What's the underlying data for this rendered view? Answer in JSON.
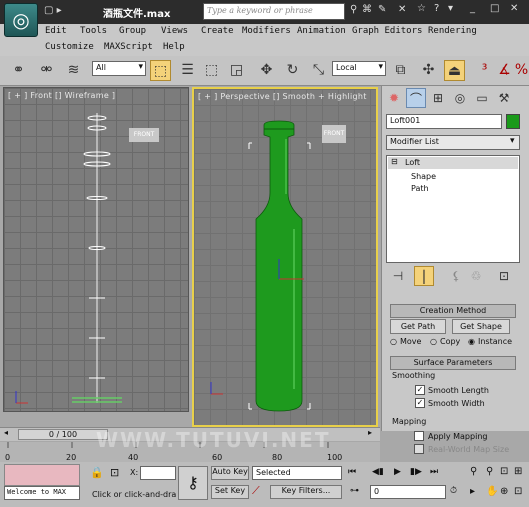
{
  "title": {
    "filename": "酒瓶文件.max",
    "search_placeholder": "Type a keyword or phrase"
  },
  "menu": {
    "edit": "Edit",
    "tools": "Tools",
    "group": "Group",
    "views": "Views",
    "create": "Create",
    "modifiers": "Modifiers",
    "animation": "Animation",
    "graph_editors": "Graph Editors",
    "rendering": "Rendering",
    "customize": "Customize",
    "maxscript": "MAXScript",
    "help": "Help"
  },
  "toolbar": {
    "selection_filter": "All",
    "ref_coord": "Local"
  },
  "viewports": {
    "front": "[ + ] Front [] Wireframe ]",
    "perspective": "[ + ] Perspective [] Smooth + Highlight",
    "view_cube": "FRONT"
  },
  "panel": {
    "object_name": "Loft001",
    "object_color": "#1a9a1a",
    "modifier_list": "Modifier List",
    "stack": [
      {
        "label": "Loft",
        "expander": "⊟"
      },
      {
        "label": "Shape"
      },
      {
        "label": "Path"
      }
    ],
    "creation_method": {
      "title": "Creation Method",
      "get_path": "Get Path",
      "get_shape": "Get Shape",
      "move": "Move",
      "copy": "Copy",
      "instance": "Instance"
    },
    "surface_params": {
      "title": "Surface Parameters",
      "smoothing": "Smoothing",
      "smooth_length": "Smooth Length",
      "smooth_width": "Smooth Width",
      "mapping": "Mapping",
      "apply_mapping": "Apply Mapping",
      "real_world": "Real-World Map Size"
    }
  },
  "timeline": {
    "frame": "0 / 100",
    "ticks": [
      "0",
      "20",
      "40",
      "60",
      "80",
      "100"
    ]
  },
  "status": {
    "maxscript": "Welcome to MAX",
    "prompt": "Click or click-and-dra",
    "x_label": "X:",
    "auto_key": "Auto Key",
    "set_key": "Set Key",
    "key_filters": "Key Filters...",
    "selected": "Selected",
    "frame_field": "0",
    "watermark": "WWW.TUTUVI.NET"
  }
}
